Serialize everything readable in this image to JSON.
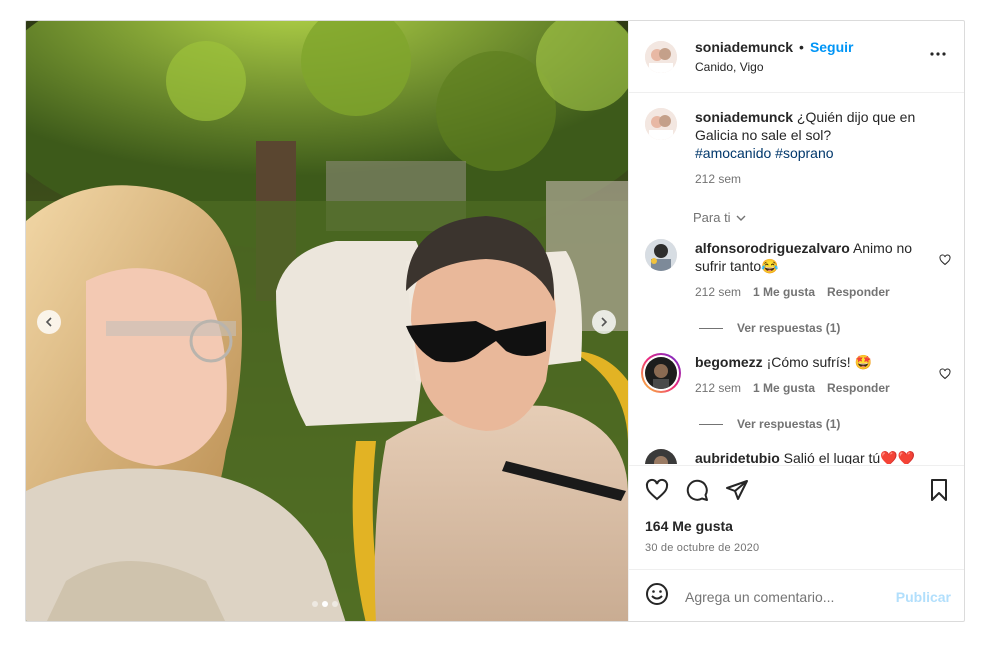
{
  "post": {
    "username": "soniademunck",
    "dot": "•",
    "follow_label": "Seguir",
    "location": "Canido, Vigo",
    "more_icon": "more-horizontal-icon"
  },
  "caption": {
    "username": "soniademunck",
    "text": "¿Quién dijo que en Galicia no sale el sol?",
    "hashtags": "#amocanido #soprano",
    "time": "212 sem"
  },
  "para_ti": "Para ti",
  "comments": [
    {
      "username": "alfonsorodriguezalvaro",
      "text": "Animo no sufrir tanto😂",
      "time": "212 sem",
      "likes": "1 Me gusta",
      "reply": "Responder",
      "view_replies": "Ver respuestas (1)"
    },
    {
      "username": "begomezz",
      "text": "¡Cómo sufrís! 🤩",
      "time": "212 sem",
      "likes": "1 Me gusta",
      "reply": "Responder",
      "view_replies": "Ver respuestas (1)"
    },
    {
      "username": "aubridetubio",
      "text": "Salió el lugar tú❤️❤️"
    }
  ],
  "engagement": {
    "likes": "164 Me gusta",
    "date": "30 de octubre de 2020"
  },
  "composer": {
    "placeholder": "Agrega un comentario...",
    "publish_label": "Publicar"
  },
  "carousel": {
    "slide_count": 3,
    "active_slide": 2
  },
  "colors": {
    "link_blue": "#0095f6",
    "hashtag": "#00376b",
    "muted": "#737373",
    "publish_disabled": "#b2dffc"
  }
}
